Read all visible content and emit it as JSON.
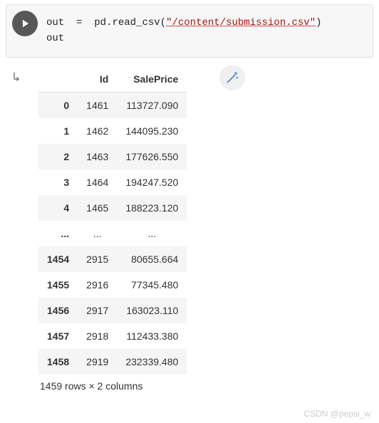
{
  "code": {
    "var1": "out",
    "var2": "out",
    "assign": "  =  ",
    "module": "pd",
    "func": "read_csv",
    "string": "\"/content/submission.csv\""
  },
  "table": {
    "columns": [
      "Id",
      "SalePrice"
    ],
    "head": [
      {
        "idx": "0",
        "Id": "1461",
        "SalePrice": "113727.090"
      },
      {
        "idx": "1",
        "Id": "1462",
        "SalePrice": "144095.230"
      },
      {
        "idx": "2",
        "Id": "1463",
        "SalePrice": "177626.550"
      },
      {
        "idx": "3",
        "Id": "1464",
        "SalePrice": "194247.520"
      },
      {
        "idx": "4",
        "Id": "1465",
        "SalePrice": "188223.120"
      }
    ],
    "tail": [
      {
        "idx": "1454",
        "Id": "2915",
        "SalePrice": "80655.664"
      },
      {
        "idx": "1455",
        "Id": "2916",
        "SalePrice": "77345.480"
      },
      {
        "idx": "1456",
        "Id": "2917",
        "SalePrice": "163023.110"
      },
      {
        "idx": "1457",
        "Id": "2918",
        "SalePrice": "112433.380"
      },
      {
        "idx": "1458",
        "Id": "2919",
        "SalePrice": "232339.480"
      }
    ],
    "ellipsis": "...",
    "shape": "1459 rows × 2 columns"
  },
  "watermark": "CSDN @pepsi_w"
}
